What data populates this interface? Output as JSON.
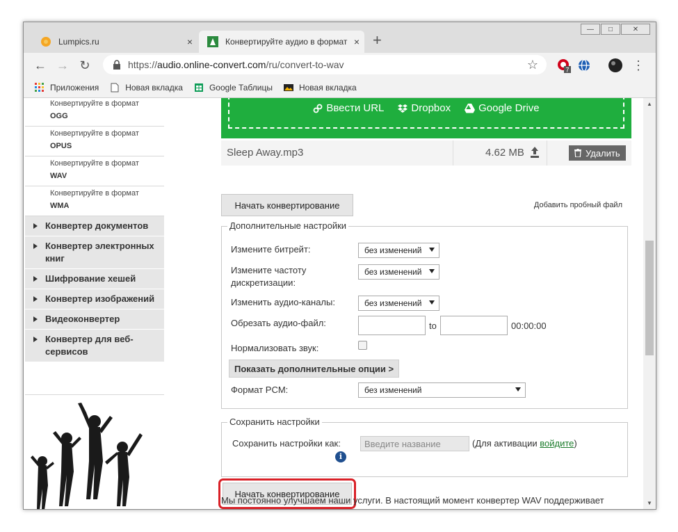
{
  "window_controls": {
    "minimize": "—",
    "maximize": "□",
    "close": "✕"
  },
  "tabs": [
    {
      "title": "Lumpics.ru",
      "close": "×"
    },
    {
      "title": "Конвертируйте аудио в формат",
      "close": "×"
    }
  ],
  "new_tab": "+",
  "address": {
    "scheme": "https://",
    "host": "audio.online-convert.com",
    "path": "/ru/convert-to-wav"
  },
  "extension_badge": "7",
  "bookmarks": [
    "Приложения",
    "Новая вкладка",
    "Google Таблицы",
    "Новая вкладка"
  ],
  "sidebar": {
    "subitems": [
      {
        "prefix": "Конвертируйте в формат",
        "format": "OGG"
      },
      {
        "prefix": "Конвертируйте в формат",
        "format": "OPUS"
      },
      {
        "prefix": "Конвертируйте в формат",
        "format": "WAV"
      },
      {
        "prefix": "Конвертируйте в формат",
        "format": "WMA"
      }
    ],
    "categories": [
      "Конвертер документов",
      "Конвертер электронных книг",
      "Шифрование хешей",
      "Конвертер изображений",
      "Видеоконвертер",
      "Конвертер для веб-сервисов"
    ]
  },
  "upload": {
    "url": "Ввести URL",
    "dropbox": "Dropbox",
    "gdrive": "Google Drive"
  },
  "file": {
    "name": "Sleep Away.mp3",
    "size": "4.62 MB",
    "delete": "Удалить"
  },
  "start_button": "Начать конвертирование",
  "add_sample": "Добавить пробный файл",
  "advanced": {
    "legend": "Дополнительные настройки",
    "bitrate_label": "Измените битрейт:",
    "bitrate_value": "без изменений",
    "samplerate_label": "Измените частоту дискретизации:",
    "samplerate_value": "без изменений",
    "channels_label": "Изменить аудио-каналы:",
    "channels_value": "без изменений",
    "trim_label": "Обрезать аудио-файл:",
    "trim_to": "to",
    "trim_time": "00:00:00",
    "normalize_label": "Нормализовать звук:",
    "show_more": "Показать дополнительные опции >",
    "pcm_label": "Формат PCM:",
    "pcm_value": "без изменений"
  },
  "save_settings": {
    "legend": "Сохранить настройки",
    "label": "Сохранить настройки как:",
    "placeholder": "Введите название",
    "note_before": "(Для активации ",
    "note_link": "войдите",
    "note_after": ")"
  },
  "bottom_text": "Мы постоянно улучшаем наши услуги. В настоящий момент конвертер WAV поддерживает"
}
